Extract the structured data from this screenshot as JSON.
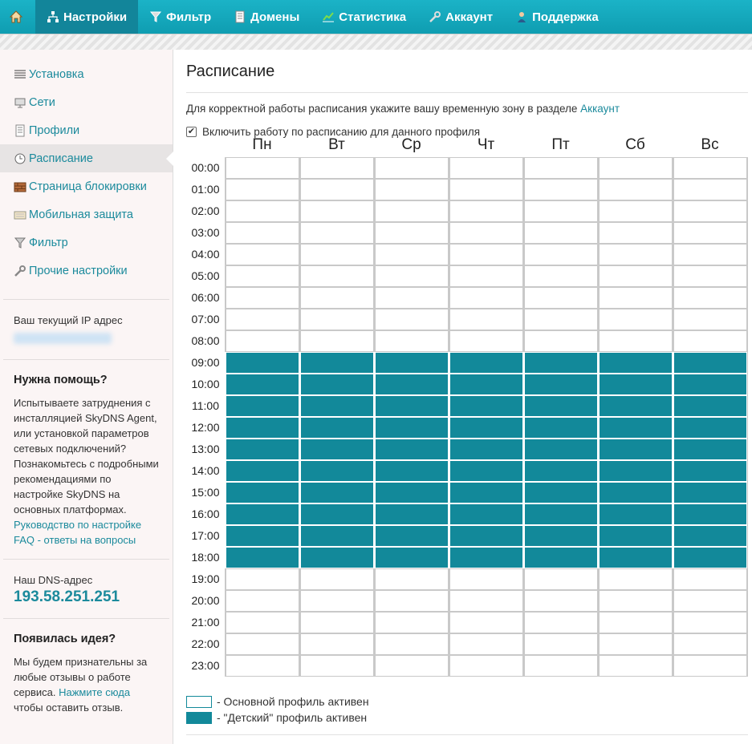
{
  "colors": {
    "accent": "#1b8a9c",
    "nav_bg": "#12a6bb",
    "active_cell": "#12899a",
    "inactive_cell": "#ffffff"
  },
  "topnav": {
    "home_icon": "home-icon",
    "items": [
      {
        "label": "Настройки",
        "icon": "network-icon",
        "active": true
      },
      {
        "label": "Фильтр",
        "icon": "filter-icon",
        "active": false
      },
      {
        "label": "Домены",
        "icon": "document-icon",
        "active": false
      },
      {
        "label": "Статистика",
        "icon": "chart-icon",
        "active": false
      },
      {
        "label": "Аккаунт",
        "icon": "wrench-icon",
        "active": false
      },
      {
        "label": "Поддержка",
        "icon": "person-icon",
        "active": false
      }
    ]
  },
  "sidebar": {
    "items": [
      {
        "label": "Установка",
        "icon": "list-icon"
      },
      {
        "label": "Сети",
        "icon": "network-icon"
      },
      {
        "label": "Профили",
        "icon": "document-icon"
      },
      {
        "label": "Расписание",
        "icon": "clock-icon",
        "active": true
      },
      {
        "label": "Страница блокировки",
        "icon": "brick-icon"
      },
      {
        "label": "Мобильная защита",
        "icon": "mobile-icon"
      },
      {
        "label": "Фильтр",
        "icon": "filter-icon"
      },
      {
        "label": "Прочие настройки",
        "icon": "wrench-icon"
      }
    ],
    "ip_label": "Ваш текущий IP адрес",
    "help": {
      "title": "Нужна помощь?",
      "text": "Испытываете затруднения с инсталляцией SkyDNS Agent, или установкой параметров сетевых подключений? Познакомьтесь с подробными рекомендациями по настройке SkyDNS на основных платформах.",
      "link_guide": "Руководство по настройке",
      "link_faq": "FAQ - ответы на вопросы"
    },
    "dns": {
      "label": "Наш DNS-адрес",
      "address": "193.58.251.251"
    },
    "idea": {
      "title": "Появилась идея?",
      "text_before": "Мы будем признательны за любые отзывы о работе сервиса.",
      "link": "Нажмите сюда",
      "text_after": "чтобы оставить отзыв."
    }
  },
  "main": {
    "title": "Расписание",
    "tz_note": "Для корректной работы расписания укажите вашу временную зону в разделе",
    "tz_link": "Аккаунт",
    "enable_label": "Включить работу по расписанию для данного профиля",
    "enable_checked": true
  },
  "schedule": {
    "days": [
      "Пн",
      "Вт",
      "Ср",
      "Чт",
      "Пт",
      "Сб",
      "Вс"
    ],
    "hours": [
      "00:00",
      "01:00",
      "02:00",
      "03:00",
      "04:00",
      "05:00",
      "06:00",
      "07:00",
      "08:00",
      "09:00",
      "10:00",
      "11:00",
      "12:00",
      "13:00",
      "14:00",
      "15:00",
      "16:00",
      "17:00",
      "18:00",
      "19:00",
      "20:00",
      "21:00",
      "22:00",
      "23:00"
    ],
    "active_from_hour": 9,
    "active_to_hour": 18
  },
  "legend": {
    "main_profile": "- Основной профиль активен",
    "child_profile": "- \"Детский\" профиль активен"
  }
}
